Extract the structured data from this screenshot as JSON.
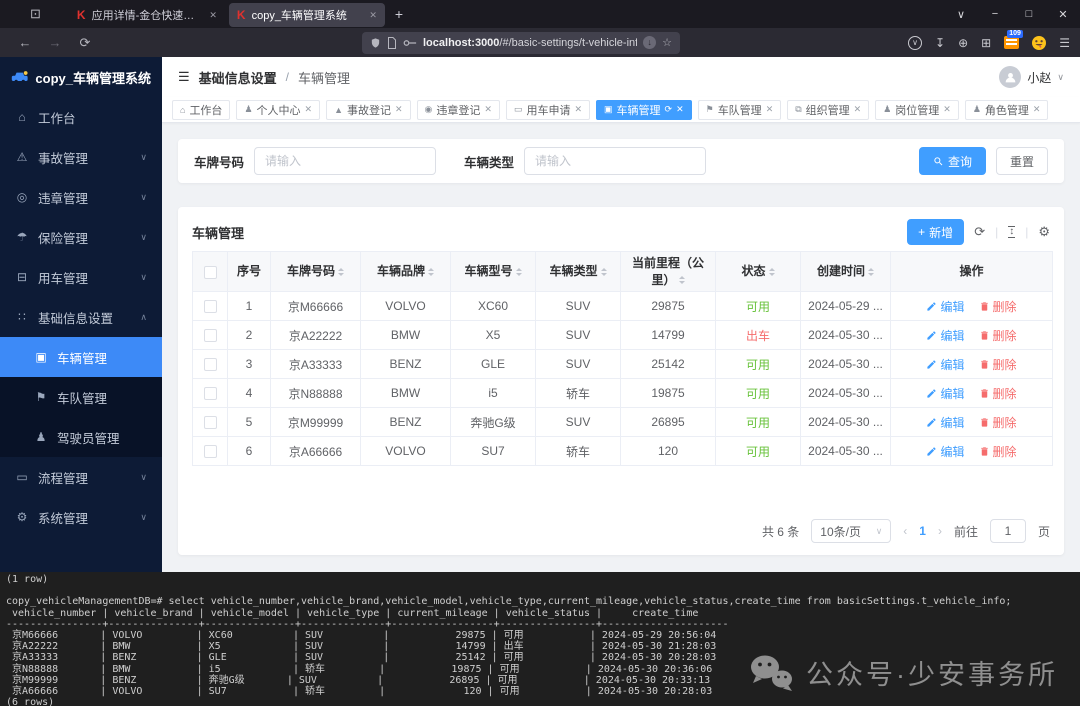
{
  "glyphs": {
    "window": "⊡",
    "back": "←",
    "forward": "→",
    "reload": "⟳",
    "star": "☆",
    "pocket": "∨",
    "download": "↧",
    "globe": "⊕",
    "extension": "⊞",
    "menu": "☰",
    "tabs_chevron": "∨",
    "minimize": "−",
    "maximize": "□",
    "close": "✕",
    "newtab": "+",
    "collapse": "☰",
    "user_chevron": "∨",
    "plus": "+",
    "refresh": "⟳",
    "gear": "⚙",
    "prev": "‹",
    "next": "›",
    "select_chevron": "∨",
    "circle_download": "↓",
    "density": "↕"
  },
  "browser": {
    "tabs": [
      {
        "title": "应用详情-金仓快速开发与运维",
        "favicon": "K",
        "active": false,
        "closable": true
      },
      {
        "title": "copy_车辆管理系统",
        "favicon": "K",
        "active": true,
        "closable": true
      }
    ],
    "url_host": "localhost:3000",
    "url_path": "/#/basic-settings/t-vehicle-info",
    "extension_badge": "109"
  },
  "app": {
    "logo_title": "copy_车辆管理系统",
    "breadcrumb": [
      "基础信息设置",
      "车辆管理"
    ],
    "user_name": "小赵"
  },
  "sidebar": {
    "items": [
      {
        "label": "工作台",
        "icon": "workbench-home-icon",
        "glyph": "⌂"
      },
      {
        "label": "事故管理",
        "icon": "accident-icon",
        "glyph": "⚠",
        "expandable": true
      },
      {
        "label": "违章管理",
        "icon": "violation-icon",
        "glyph": "◎",
        "expandable": true
      },
      {
        "label": "保险管理",
        "icon": "insurance-umbrella-icon",
        "glyph": "☂",
        "expandable": true
      },
      {
        "label": "用车管理",
        "icon": "vehicle-use-icon",
        "glyph": "⊟",
        "expandable": true
      },
      {
        "label": "基础信息设置",
        "icon": "basic-info-grid-icon",
        "glyph": "∷",
        "expandable": true,
        "expanded": true
      },
      {
        "label": "车辆管理",
        "icon": "vehicle-icon",
        "glyph": "▣",
        "sub": true,
        "active": true
      },
      {
        "label": "车队管理",
        "icon": "fleet-flag-icon",
        "glyph": "⚑",
        "sub": true
      },
      {
        "label": "驾驶员管理",
        "icon": "driver-person-icon",
        "glyph": "♟",
        "sub": true
      },
      {
        "label": "流程管理",
        "icon": "process-folder-icon",
        "glyph": "▭",
        "expandable": true
      },
      {
        "label": "系统管理",
        "icon": "system-gear-icon",
        "glyph": "⚙",
        "expandable": true
      }
    ]
  },
  "chips": [
    {
      "label": "工作台",
      "icon": "home-icon",
      "glyph": "⌂",
      "closable": false
    },
    {
      "label": "个人中心",
      "icon": "user-icon",
      "glyph": "♟",
      "closable": true
    },
    {
      "label": "事故登记",
      "icon": "accident-icon",
      "glyph": "▲",
      "closable": true
    },
    {
      "label": "违章登记",
      "icon": "violation-icon",
      "glyph": "◉",
      "closable": true
    },
    {
      "label": "用车申请",
      "icon": "car-apply-icon",
      "glyph": "▭",
      "closable": true
    },
    {
      "label": "车辆管理",
      "icon": "vehicle-icon",
      "glyph": "▣",
      "closable": true,
      "active": true,
      "refresh": true
    },
    {
      "label": "车队管理",
      "icon": "fleet-flag-icon",
      "glyph": "⚑",
      "closable": true
    },
    {
      "label": "组织管理",
      "icon": "org-icon",
      "glyph": "⧉",
      "closable": true
    },
    {
      "label": "岗位管理",
      "icon": "post-icon",
      "glyph": "♟",
      "closable": true
    },
    {
      "label": "角色管理",
      "icon": "role-icon",
      "glyph": "♟",
      "closable": true
    }
  ],
  "search": {
    "fields": [
      {
        "label": "车牌号码",
        "placeholder": "请输入"
      },
      {
        "label": "车辆类型",
        "placeholder": "请输入"
      }
    ],
    "query_label": "查询",
    "reset_label": "重置"
  },
  "panel": {
    "title": "车辆管理",
    "add_label": "新增",
    "table": {
      "columns": [
        {
          "type": "checkbox",
          "label": ""
        },
        {
          "label": "序号"
        },
        {
          "label": "车牌号码",
          "sortable": true
        },
        {
          "label": "车辆品牌",
          "sortable": true
        },
        {
          "label": "车辆型号",
          "sortable": true
        },
        {
          "label": "车辆类型",
          "sortable": true
        },
        {
          "label": "当前里程（公里）",
          "sortable": true
        },
        {
          "label": "状态",
          "sortable": true
        },
        {
          "label": "创建时间",
          "sortable": true
        },
        {
          "label": "操作"
        }
      ],
      "rows": [
        {
          "index": "1",
          "plate": "京M66666",
          "brand": "VOLVO",
          "model": "XC60",
          "type": "SUV",
          "mileage": "29875",
          "status": "可用",
          "status_type": "success",
          "time": "2024-05-29 ..."
        },
        {
          "index": "2",
          "plate": "京A22222",
          "brand": "BMW",
          "model": "X5",
          "type": "SUV",
          "mileage": "14799",
          "status": "出车",
          "status_type": "danger",
          "time": "2024-05-30 ..."
        },
        {
          "index": "3",
          "plate": "京A33333",
          "brand": "BENZ",
          "model": "GLE",
          "type": "SUV",
          "mileage": "25142",
          "status": "可用",
          "status_type": "success",
          "time": "2024-05-30 ..."
        },
        {
          "index": "4",
          "plate": "京N88888",
          "brand": "BMW",
          "model": "i5",
          "type": "轿车",
          "mileage": "19875",
          "status": "可用",
          "status_type": "success",
          "time": "2024-05-30 ..."
        },
        {
          "index": "5",
          "plate": "京M99999",
          "brand": "BENZ",
          "model": "奔驰G级",
          "type": "SUV",
          "mileage": "26895",
          "status": "可用",
          "status_type": "success",
          "time": "2024-05-30 ..."
        },
        {
          "index": "6",
          "plate": "京A66666",
          "brand": "VOLVO",
          "model": "SU7",
          "type": "轿车",
          "mileage": "120",
          "status": "可用",
          "status_type": "success",
          "time": "2024-05-30 ..."
        }
      ],
      "edit_label": "编辑",
      "delete_label": "删除"
    },
    "pagination": {
      "total_text": "共 6 条",
      "page_size": "10条/页",
      "current_page": "1",
      "goto_label": "前往",
      "goto_value": "1",
      "page_suffix": "页"
    }
  },
  "terminal": {
    "lines": [
      "(1 row)",
      "",
      "copy_vehicleManagementDB=# select vehicle_number,vehicle_brand,vehicle_model,vehicle_type,current_mileage,vehicle_status,create_time from basicSettings.t_vehicle_info;",
      " vehicle_number | vehicle_brand | vehicle_model | vehicle_type | current_mileage | vehicle_status |     create_time     ",
      "----------------+---------------+---------------+--------------+-----------------+----------------+---------------------",
      " 京M66666       | VOLVO         | XC60          | SUV          |           29875 | 可用           | 2024-05-29 20:56:04",
      " 京A22222       | BMW           | X5            | SUV          |           14799 | 出车           | 2024-05-30 21:28:03",
      " 京A33333       | BENZ          | GLE           | SUV          |           25142 | 可用           | 2024-05-30 20:28:03",
      " 京N88888       | BMW           | i5            | 轿车         |           19875 | 可用           | 2024-05-30 20:36:06",
      " 京M99999       | BENZ          | 奔驰G级       | SUV          |           26895 | 可用           | 2024-05-30 20:33:13",
      " 京A66666       | VOLVO         | SU7           | 轿车         |             120 | 可用           | 2024-05-30 20:28:03",
      "(6 rows)"
    ]
  },
  "watermark": {
    "text": "公众号·少安事务所"
  }
}
